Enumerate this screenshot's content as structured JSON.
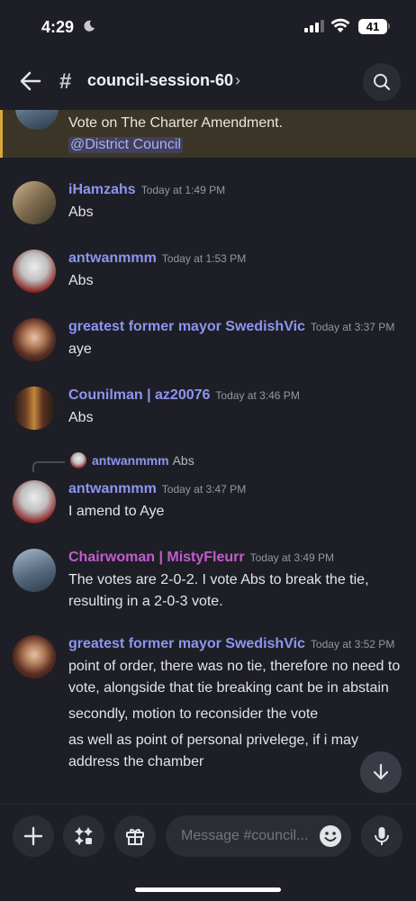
{
  "status": {
    "time": "4:29",
    "battery": "41"
  },
  "header": {
    "channel": "council-session-60",
    "chevron": "›",
    "hash": "#"
  },
  "pinned": {
    "line1": "Vote on The Charter Amendment.",
    "mention": "@District Council"
  },
  "messages": [
    {
      "user": "iHamzahs",
      "time": "Today at 1:49 PM",
      "lines": [
        "Abs"
      ]
    },
    {
      "user": "antwanmmm",
      "time": "Today at 1:53 PM",
      "lines": [
        "Abs"
      ]
    },
    {
      "user": "greatest former mayor SwedishVic",
      "time": "Today at 3:37 PM",
      "lines": [
        "aye"
      ]
    },
    {
      "user": "Counilman | az20076",
      "time": "Today at 3:46 PM",
      "lines": [
        "Abs"
      ]
    },
    {
      "reply_user": "antwanmmm",
      "reply_text": "Abs",
      "user": "antwanmmm",
      "time": "Today at 3:47 PM",
      "lines": [
        "I amend to Aye"
      ]
    },
    {
      "user": "Chairwoman | MistyFleurr",
      "time": "Today at 3:49 PM",
      "lines": [
        "The votes are 2-0-2. I vote Abs to break the tie, resulting in a 2-0-3 vote."
      ]
    },
    {
      "user": "greatest former mayor SwedishVic",
      "time": "Today at 3:52 PM",
      "lines": [
        "point of order, there was no tie, therefore no need to vote, alongside that tie breaking cant be in abstain",
        "secondly, motion to reconsider the vote",
        "as well as point of personal privelege, if i may address the chamber"
      ]
    }
  ],
  "composer": {
    "placeholder": "Message #council..."
  },
  "colors": {
    "accent": "#8c95f0",
    "chair": "#c55bd0",
    "pinned_bg": "#3b3527"
  }
}
